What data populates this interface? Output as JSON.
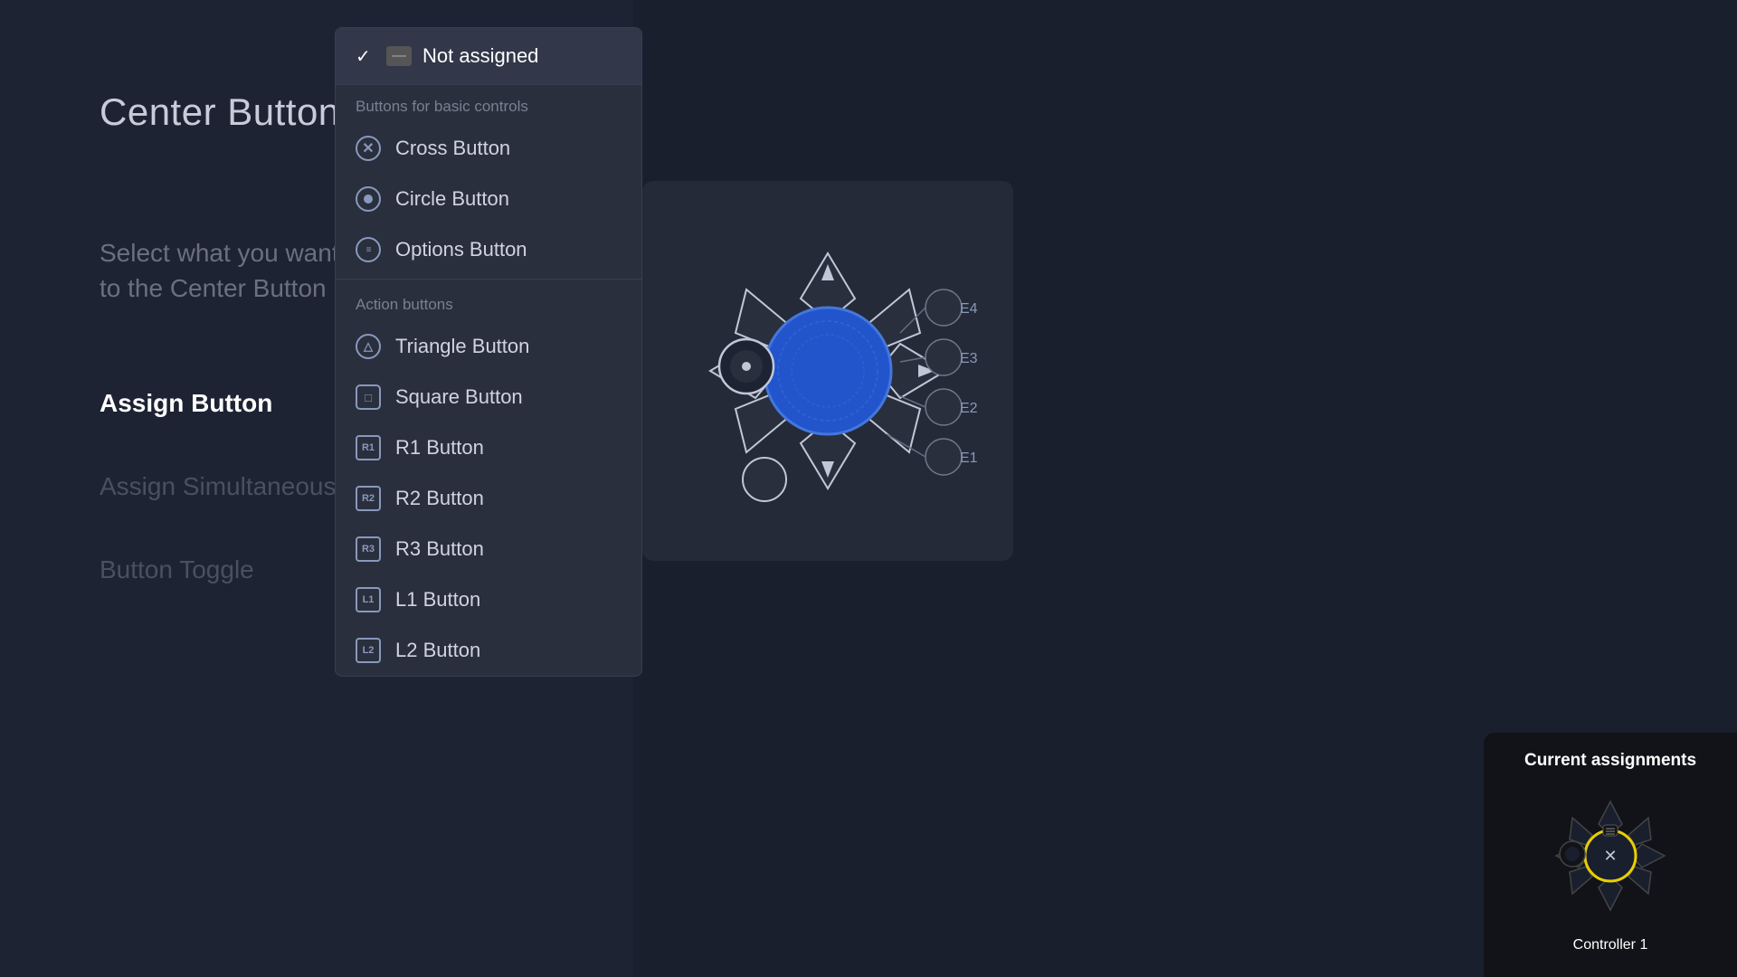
{
  "page": {
    "title": "Center Button",
    "subtitle": "Select what you want to assign to the Center Button",
    "background_color": "#1a1f2e"
  },
  "left_menu": {
    "items": [
      {
        "label": "Assign Button",
        "state": "active"
      },
      {
        "label": "Assign Simultaneous Press",
        "state": "muted"
      },
      {
        "label": "Button Toggle",
        "state": "muted"
      }
    ]
  },
  "dropdown": {
    "selected": "Not assigned",
    "selected_check": "✓",
    "selected_dash": "—",
    "sections": [
      {
        "label": "Buttons for basic controls",
        "items": [
          {
            "label": "Cross Button",
            "icon_type": "cross"
          },
          {
            "label": "Circle Button",
            "icon_type": "circle"
          },
          {
            "label": "Options Button",
            "icon_type": "options"
          }
        ]
      },
      {
        "label": "Action buttons",
        "items": [
          {
            "label": "Triangle Button",
            "icon_type": "triangle"
          },
          {
            "label": "Square Button",
            "icon_type": "square"
          },
          {
            "label": "R1 Button",
            "icon_type": "r1",
            "badge": "R1"
          },
          {
            "label": "R2 Button",
            "icon_type": "r2",
            "badge": "R2"
          },
          {
            "label": "R3 Button",
            "icon_type": "r3",
            "badge": "R3"
          },
          {
            "label": "L1 Button",
            "icon_type": "l1",
            "badge": "L1"
          },
          {
            "label": "L2 Button",
            "icon_type": "l2",
            "badge": "L2"
          }
        ]
      }
    ]
  },
  "controller": {
    "center_color": "#2255cc",
    "highlight_color": "#4477dd"
  },
  "assignments_panel": {
    "title": "Current assignments",
    "controller_label": "Controller 1"
  },
  "icons": {
    "check": "✓",
    "cross_symbol": "✕",
    "triangle_symbol": "△",
    "square_symbol": "□",
    "circle_dots": "≡",
    "r_badge": "R",
    "l_badge": "L"
  }
}
